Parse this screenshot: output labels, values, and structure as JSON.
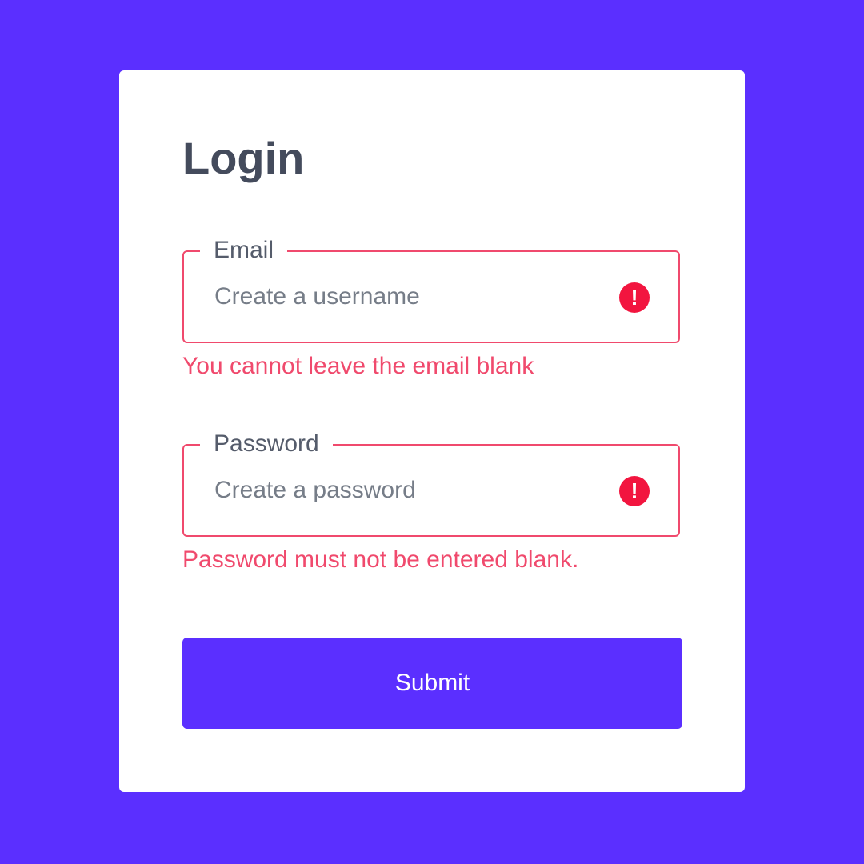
{
  "colors": {
    "background": "#5b2fff",
    "card": "#ffffff",
    "error": "#f04a6d",
    "error_icon": "#f2153f",
    "button": "#5b2fff"
  },
  "form": {
    "title": "Login",
    "email": {
      "label": "Email",
      "placeholder": "Create a username",
      "value": "",
      "icon": "alert-circle-icon",
      "error": "You cannot leave the email blank"
    },
    "password": {
      "label": "Password",
      "placeholder": "Create a password",
      "value": "",
      "icon": "alert-circle-icon",
      "error": "Password must not be entered blank."
    },
    "submit_label": "Submit"
  }
}
